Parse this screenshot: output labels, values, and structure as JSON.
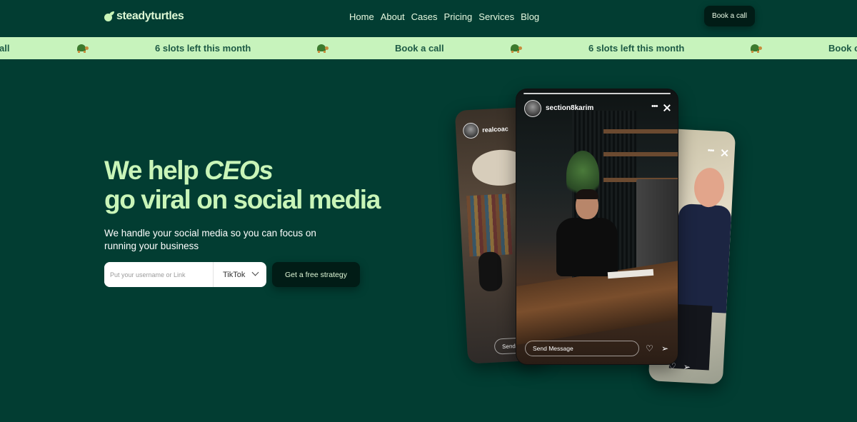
{
  "nav": {
    "logo": "steadyturtles",
    "links": [
      "Home",
      "About",
      "Cases",
      "Pricing",
      "Services",
      "Blog"
    ],
    "cta": "Book a call"
  },
  "ticker": {
    "items": [
      "all",
      "6 slots left this month",
      "Book a call",
      "6 slots left this month",
      "Book c"
    ]
  },
  "hero": {
    "title_prefix": "We help ",
    "title_strong": "CEOs",
    "title_line2": "go viral on social media",
    "subtitle": "We handle your social media so you can focus on running your business",
    "input_placeholder": "Put your username or Link",
    "platform": "TikTok",
    "cta": "Get a free strategy"
  },
  "stories": {
    "main": {
      "username": "section8karim",
      "message_placeholder": "Send Message"
    },
    "left": {
      "username": "realcoac",
      "message_placeholder": "Send Me"
    },
    "right": {}
  },
  "colors": {
    "background": "#023d32",
    "accent": "#c9f5b8",
    "ticker_bg": "#c7f3bc",
    "button_dark": "#011c16"
  }
}
